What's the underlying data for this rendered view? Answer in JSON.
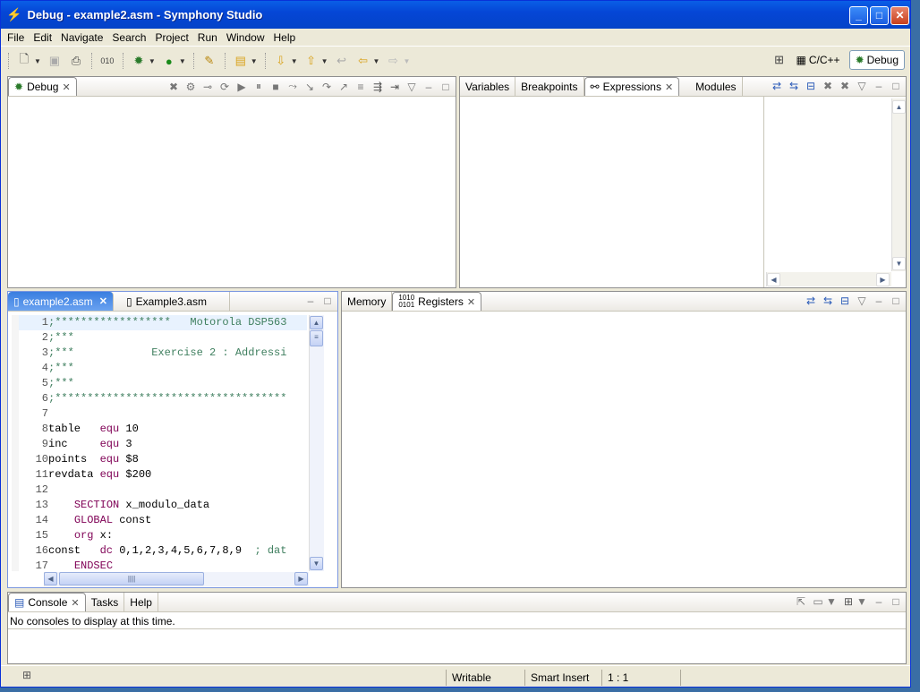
{
  "window": {
    "title": "Debug - example2.asm - Symphony Studio"
  },
  "menu": [
    "File",
    "Edit",
    "Navigate",
    "Search",
    "Project",
    "Run",
    "Window",
    "Help"
  ],
  "perspectives": {
    "cpp": "C/C++",
    "debug": "Debug"
  },
  "debug_view": {
    "tab": "Debug"
  },
  "vars_view": {
    "tabs": [
      "Variables",
      "Breakpoints",
      "Expressions",
      "Modules"
    ],
    "active": "Expressions"
  },
  "editor": {
    "tabs": [
      "example2.asm",
      "Example3.asm"
    ],
    "active": "example2.asm",
    "lines": [
      {
        "n": "1",
        "text": ";******************   Motorola DSP563",
        "type": "cmt"
      },
      {
        "n": "2",
        "text": ";***",
        "type": "cmt"
      },
      {
        "n": "3",
        "text": ";***            Exercise 2 : Addressi",
        "type": "cmt"
      },
      {
        "n": "4",
        "text": ";***",
        "type": "cmt"
      },
      {
        "n": "5",
        "text": ";***",
        "type": "cmt"
      },
      {
        "n": "6",
        "text": ";************************************",
        "type": "cmt"
      },
      {
        "n": "7",
        "text": "",
        "type": "plain"
      },
      {
        "n": "8",
        "label": "table",
        "kw": "equ",
        "rest": "10",
        "type": "equ"
      },
      {
        "n": "9",
        "label": "inc",
        "kw": "equ",
        "rest": "3",
        "type": "equ"
      },
      {
        "n": "10",
        "label": "points",
        "kw": "equ",
        "rest": "$8",
        "type": "equ"
      },
      {
        "n": "11",
        "label": "revdata",
        "kw": "equ",
        "rest": "$200",
        "type": "equ"
      },
      {
        "n": "12",
        "text": "",
        "type": "plain"
      },
      {
        "n": "13",
        "kw": "SECTION",
        "rest": "x_modulo_data",
        "type": "ind"
      },
      {
        "n": "14",
        "kw": "GLOBAL",
        "rest": "const",
        "type": "ind"
      },
      {
        "n": "15",
        "kw": "org",
        "rest": "x:",
        "type": "ind"
      },
      {
        "n": "16",
        "label": "const",
        "kw": "dc",
        "rest": "0,1,2,3,4,5,6,7,8,9",
        "comment": "; dat",
        "type": "dc"
      },
      {
        "n": "17",
        "kw": "ENDSEC",
        "rest": "",
        "type": "ind"
      }
    ]
  },
  "memory_view": {
    "tabs": [
      "Memory",
      "Registers"
    ],
    "active": "Registers"
  },
  "console_view": {
    "tabs": [
      "Console",
      "Tasks",
      "Help"
    ],
    "active": "Console",
    "message": "No consoles to display at this time."
  },
  "status": {
    "writable": "Writable",
    "insert": "Smart Insert",
    "position": "1 : 1"
  }
}
